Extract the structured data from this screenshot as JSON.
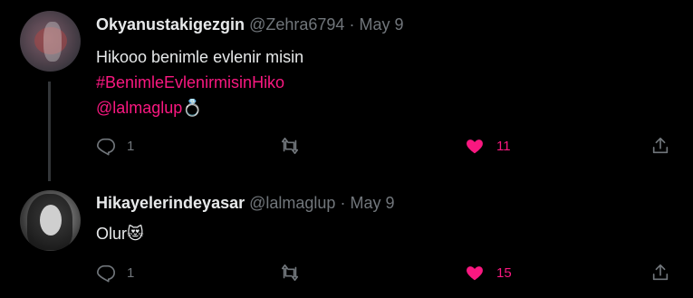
{
  "colors": {
    "accent_pink": "#f91880",
    "muted": "#71767b",
    "text": "#e7e9ea",
    "background": "#000000"
  },
  "tweets": [
    {
      "display_name": "Okyanustakigezgin",
      "handle": "@Zehra6794",
      "separator": "·",
      "date": "May 9",
      "text_line1": "Hikooo benimle evlenir misin",
      "hashtag": "#BenimleEvlenirmisinHiko",
      "mention": "@lalmaglup",
      "emoji": "💍",
      "reply_count": "1",
      "like_count": "11",
      "liked": true,
      "icons": [
        "reply-icon",
        "retweet-icon",
        "heart-filled-icon",
        "share-icon"
      ]
    },
    {
      "display_name": "Hikayelerindeyasar",
      "handle": "@lalmaglup",
      "separator": "·",
      "date": "May 9",
      "text_line1": "Olur",
      "emoji": "😻",
      "reply_count": "1",
      "like_count": "15",
      "liked": true,
      "icons": [
        "reply-icon",
        "retweet-icon",
        "heart-filled-icon",
        "share-icon"
      ]
    }
  ]
}
